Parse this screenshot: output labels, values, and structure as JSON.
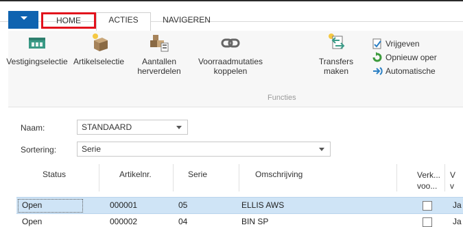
{
  "ribbon_tabs": [
    {
      "label": "HOME"
    },
    {
      "label": "ACTIES"
    },
    {
      "label": "NAVIGEREN"
    }
  ],
  "ribbon_buttons": [
    {
      "label_lines": [
        "Vestigingselectie"
      ]
    },
    {
      "label_lines": [
        "Artikelselectie"
      ]
    },
    {
      "label_lines": [
        "Aantallen",
        "herverdelen"
      ]
    },
    {
      "label_lines": [
        "Voorraadmutaties",
        "koppelen"
      ]
    },
    {
      "label_lines": [
        "Transfers",
        "maken"
      ]
    }
  ],
  "ribbon_group_label": "Functies",
  "small_actions": [
    {
      "label": "Vrijgeven",
      "icon": "release-icon"
    },
    {
      "label": "Opnieuw oper",
      "icon": "reopen-icon"
    },
    {
      "label": "Automatische",
      "icon": "auto-icon"
    }
  ],
  "filters": {
    "naam_label": "Naam:",
    "naam_value": "STANDAARD",
    "sortering_label": "Sortering:",
    "sortering_value": "Serie"
  },
  "grid": {
    "columns": [
      "Status",
      "Artikelnr.",
      "Serie",
      "Omschrijving",
      "Verk... voo...",
      "V v"
    ],
    "rows": [
      {
        "status": "Open",
        "artikelnr": "000001",
        "serie": "05",
        "omschrijving": "ELLIS AWS",
        "checked": false,
        "extra": "Ja"
      },
      {
        "status": "Open",
        "artikelnr": "000002",
        "serie": "04",
        "omschrijving": "BIN SP",
        "checked": false,
        "extra": "Ja"
      }
    ]
  },
  "colors": {
    "accent_blue": "#0f63b0",
    "highlight_red": "#e2111c",
    "selected_row": "#cfe4f6"
  }
}
